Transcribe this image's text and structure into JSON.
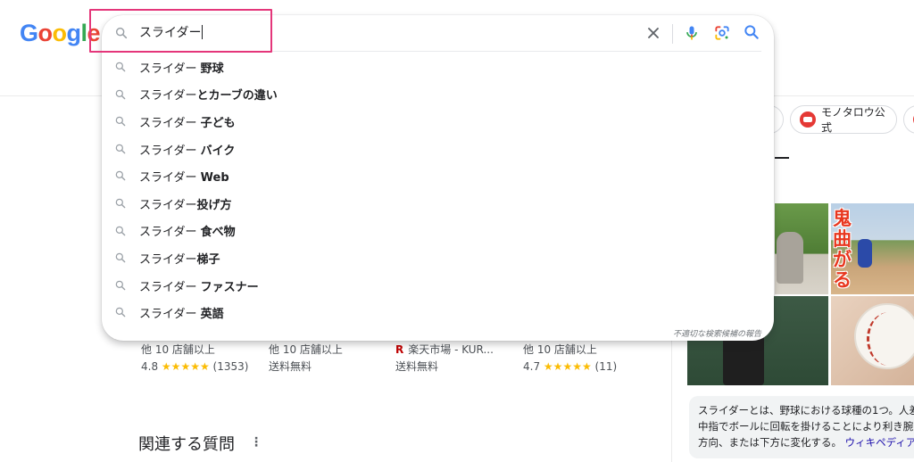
{
  "logo": {
    "letters": [
      "G",
      "o",
      "o",
      "g",
      "l",
      "e"
    ]
  },
  "search": {
    "query": "スライダー",
    "icons": {
      "left": "search-icon",
      "clear": "close-icon",
      "voice": "microphone-icon",
      "lens": "google-lens-icon",
      "submit": "search-icon"
    }
  },
  "suggestions": [
    {
      "prefix": "スライダー ",
      "bold": "野球"
    },
    {
      "prefix": "スライダー",
      "bold": "とカーブの違い"
    },
    {
      "prefix": "スライダー ",
      "bold": "子ども"
    },
    {
      "prefix": "スライダー ",
      "bold": "バイク"
    },
    {
      "prefix": "スライダー ",
      "bold": "Web"
    },
    {
      "prefix": "スライダー",
      "bold": "投げ方"
    },
    {
      "prefix": "スライダー ",
      "bold": "食べ物"
    },
    {
      "prefix": "スライダー",
      "bold": "梯子"
    },
    {
      "prefix": "スライダー ",
      "bold": "ファスナー"
    },
    {
      "prefix": "スライダー ",
      "bold": "英語"
    }
  ],
  "report_link": "不適切な検索候補の報告",
  "chips": [
    {
      "label": ""
    },
    {
      "label": "モノタロウ公式"
    },
    {
      "label": ""
    }
  ],
  "knowledge_panel": {
    "image_overlay_text": "鬼曲がる",
    "description_lines": [
      "スライダーとは、野球における球種の1つ。人差",
      "中指でボールに回転を掛けることにより利き腕",
      "方向、または下方に変化する。"
    ],
    "description_link": "ウィキペディア"
  },
  "products": [
    {
      "line1": "他 10 店舗以上",
      "line2_rating": "4.8",
      "line2_stars": "★★★★★",
      "line2_count": "(1353)"
    },
    {
      "line1": "他 10 店舗以上",
      "line2_text": "送料無料"
    },
    {
      "line1": "楽天市場 - KUR...",
      "line1_mark": "R",
      "line2_text": "送料無料"
    },
    {
      "line1": "他 10 店舗以上",
      "line2_rating": "4.7",
      "line2_stars": "★★★★★",
      "line2_count": "(11)"
    }
  ],
  "related_questions": {
    "title": "関連する質問",
    "menu": "⋮"
  },
  "colors": {
    "highlight_border": "#e4367a",
    "star": "#fbbc04",
    "link": "#1a0dab"
  }
}
